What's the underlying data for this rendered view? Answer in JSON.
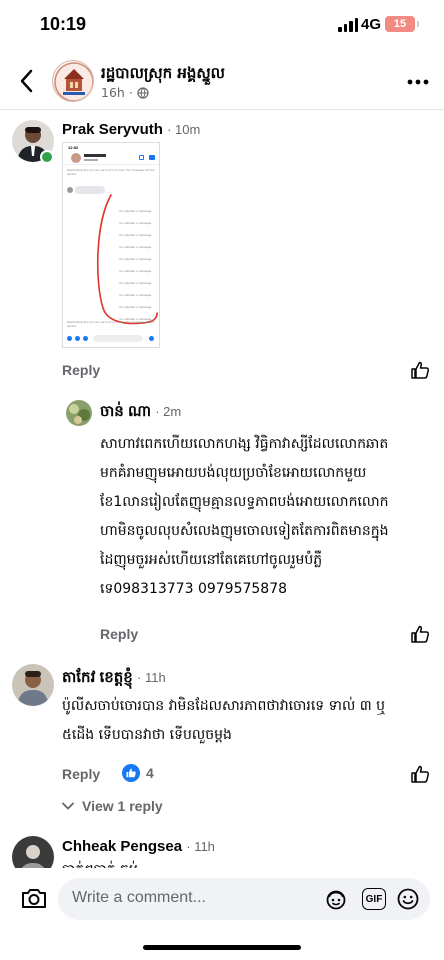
{
  "status_bar": {
    "time": "10:19",
    "network": "4G",
    "battery": "15"
  },
  "header": {
    "page_name": "រដ្ឋបាលស្រុក អង្គស្នួល",
    "time": "16h"
  },
  "comments": [
    {
      "author": "Prak Seryvuth",
      "time": "10m",
      "reply_label": "Reply",
      "attachment": {
        "time": "12:52",
        "top_note": "Deactivating this account, we're sorry to hear. Your messages will still appear.",
        "messages": [
          "You deleted a message",
          "You deleted a message",
          "You deleted a message",
          "You deleted a message",
          "You deleted a message",
          "You deleted a message",
          "You deleted a message",
          "You deleted a message",
          "You deleted a message",
          "You deleted a message"
        ],
        "bottom_note": "Deactivating this account, we're sorry to hear. Your messages will still appear."
      }
    },
    {
      "author": "ចាន់ ណា",
      "time": "2m",
      "lines": [
        "សាហាវពេកហើយលោកហង្ស វិធ្វិកាវាស្សីដែលលោកឆាត",
        "មកគំរាមញុមអោយបង់លុយប្រចាំខែអោយលោកមួយ",
        "ខែ1លានរៀលតែញុមគ្មានលទ្ធភាពបង់អោយលោកលោក",
        "ហាមិនចូលលុបសំលេងញុមចោលទៀតតែការពិតមានក្នុង",
        "ដៃញុមចួរអស់ហើយនៅតែគេហៅចូលរួមបំភ្លឺ",
        "ទេ098313773 0979575878"
      ],
      "reply_label": "Reply"
    },
    {
      "author": "តាកែវ ខេត្តខ្ញុំ",
      "time": "11h",
      "lines": [
        "ប៉ូលីសចាប់ចោរបាន វាមិនដែលសារភាពថាវាចោរទេ ទាល់ ៣ ឬ",
        "៥ដើង ទើបបានវាថា ទើបលួចម្តង"
      ],
      "reply_label": "Reply",
      "reaction_count": "4",
      "view_replies_label": "View 1 reply"
    },
    {
      "author": "Chheak Pengsea",
      "time": "11h",
      "lines": [
        "បាត់ៗបាត់ ចប់"
      ]
    }
  ],
  "composer": {
    "placeholder": "Write a comment...",
    "gif_label": "GIF"
  },
  "colors": {
    "meta_gray": "#65676b",
    "like_blue": "#1877f2",
    "annotation_red": "#e0352b"
  }
}
